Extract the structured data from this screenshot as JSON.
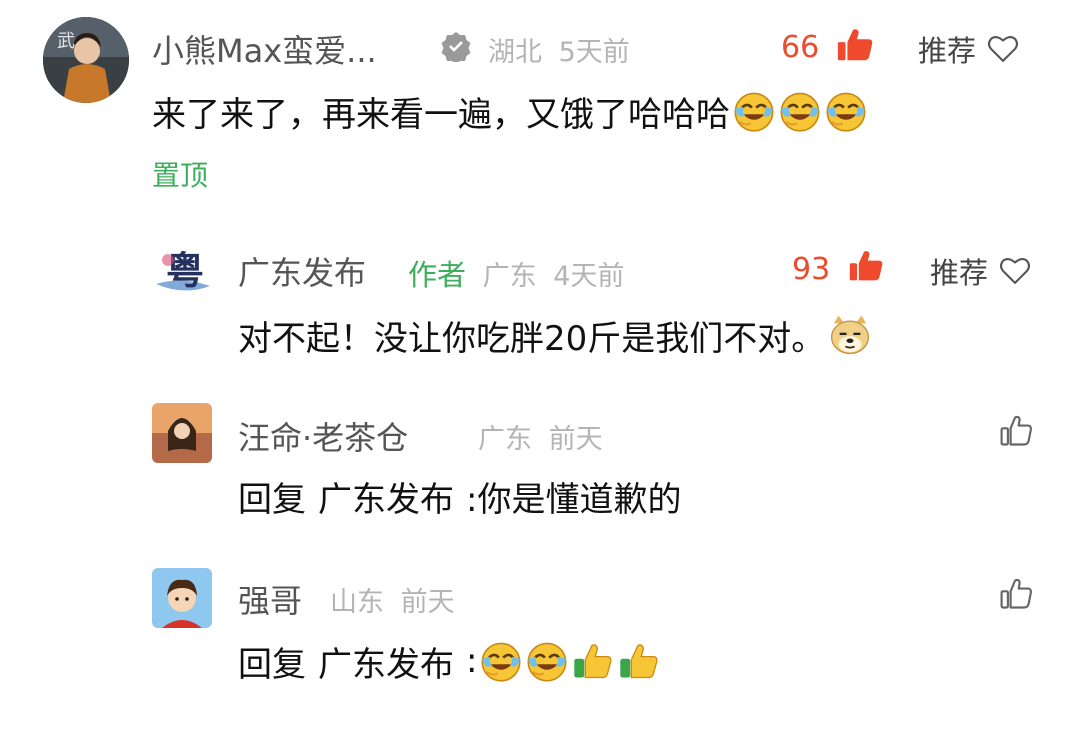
{
  "comments": [
    {
      "name": "小熊Max蛮爱...",
      "location": "湖北",
      "time": "5天前",
      "likes": "66",
      "recommend_label": "推荐",
      "text": "来了来了，再来看一遍，又饿了哈哈哈",
      "emojis": [
        "laugh-cry-emoji",
        "laugh-cry-emoji",
        "laugh-cry-emoji"
      ],
      "pin_label": "置顶",
      "verified": true
    }
  ],
  "replies": [
    {
      "name": "广东发布",
      "author_tag": "作者",
      "location": "广东",
      "time": "4天前",
      "likes": "93",
      "recommend_label": "推荐",
      "text": "对不起！没让你吃胖20斤是我们不对。",
      "emojis": [
        "doge-emoji"
      ]
    },
    {
      "name": "汪命·老茶仓",
      "location": "广东",
      "time": "前天",
      "reply_prefix": "回复",
      "reply_to": "广东发布",
      "text": ":你是懂道歉的"
    },
    {
      "name": "强哥",
      "location": "山东",
      "time": "前天",
      "reply_prefix": "回复",
      "reply_to": "广东发布",
      "text": ":",
      "emojis": [
        "laugh-cry-emoji",
        "laugh-cry-emoji",
        "thumbs-up-emoji",
        "thumbs-up-emoji"
      ]
    }
  ],
  "colors": {
    "like_red": "#f04a2e",
    "green": "#3cae5c",
    "meta_gray": "#b4b4b4"
  }
}
